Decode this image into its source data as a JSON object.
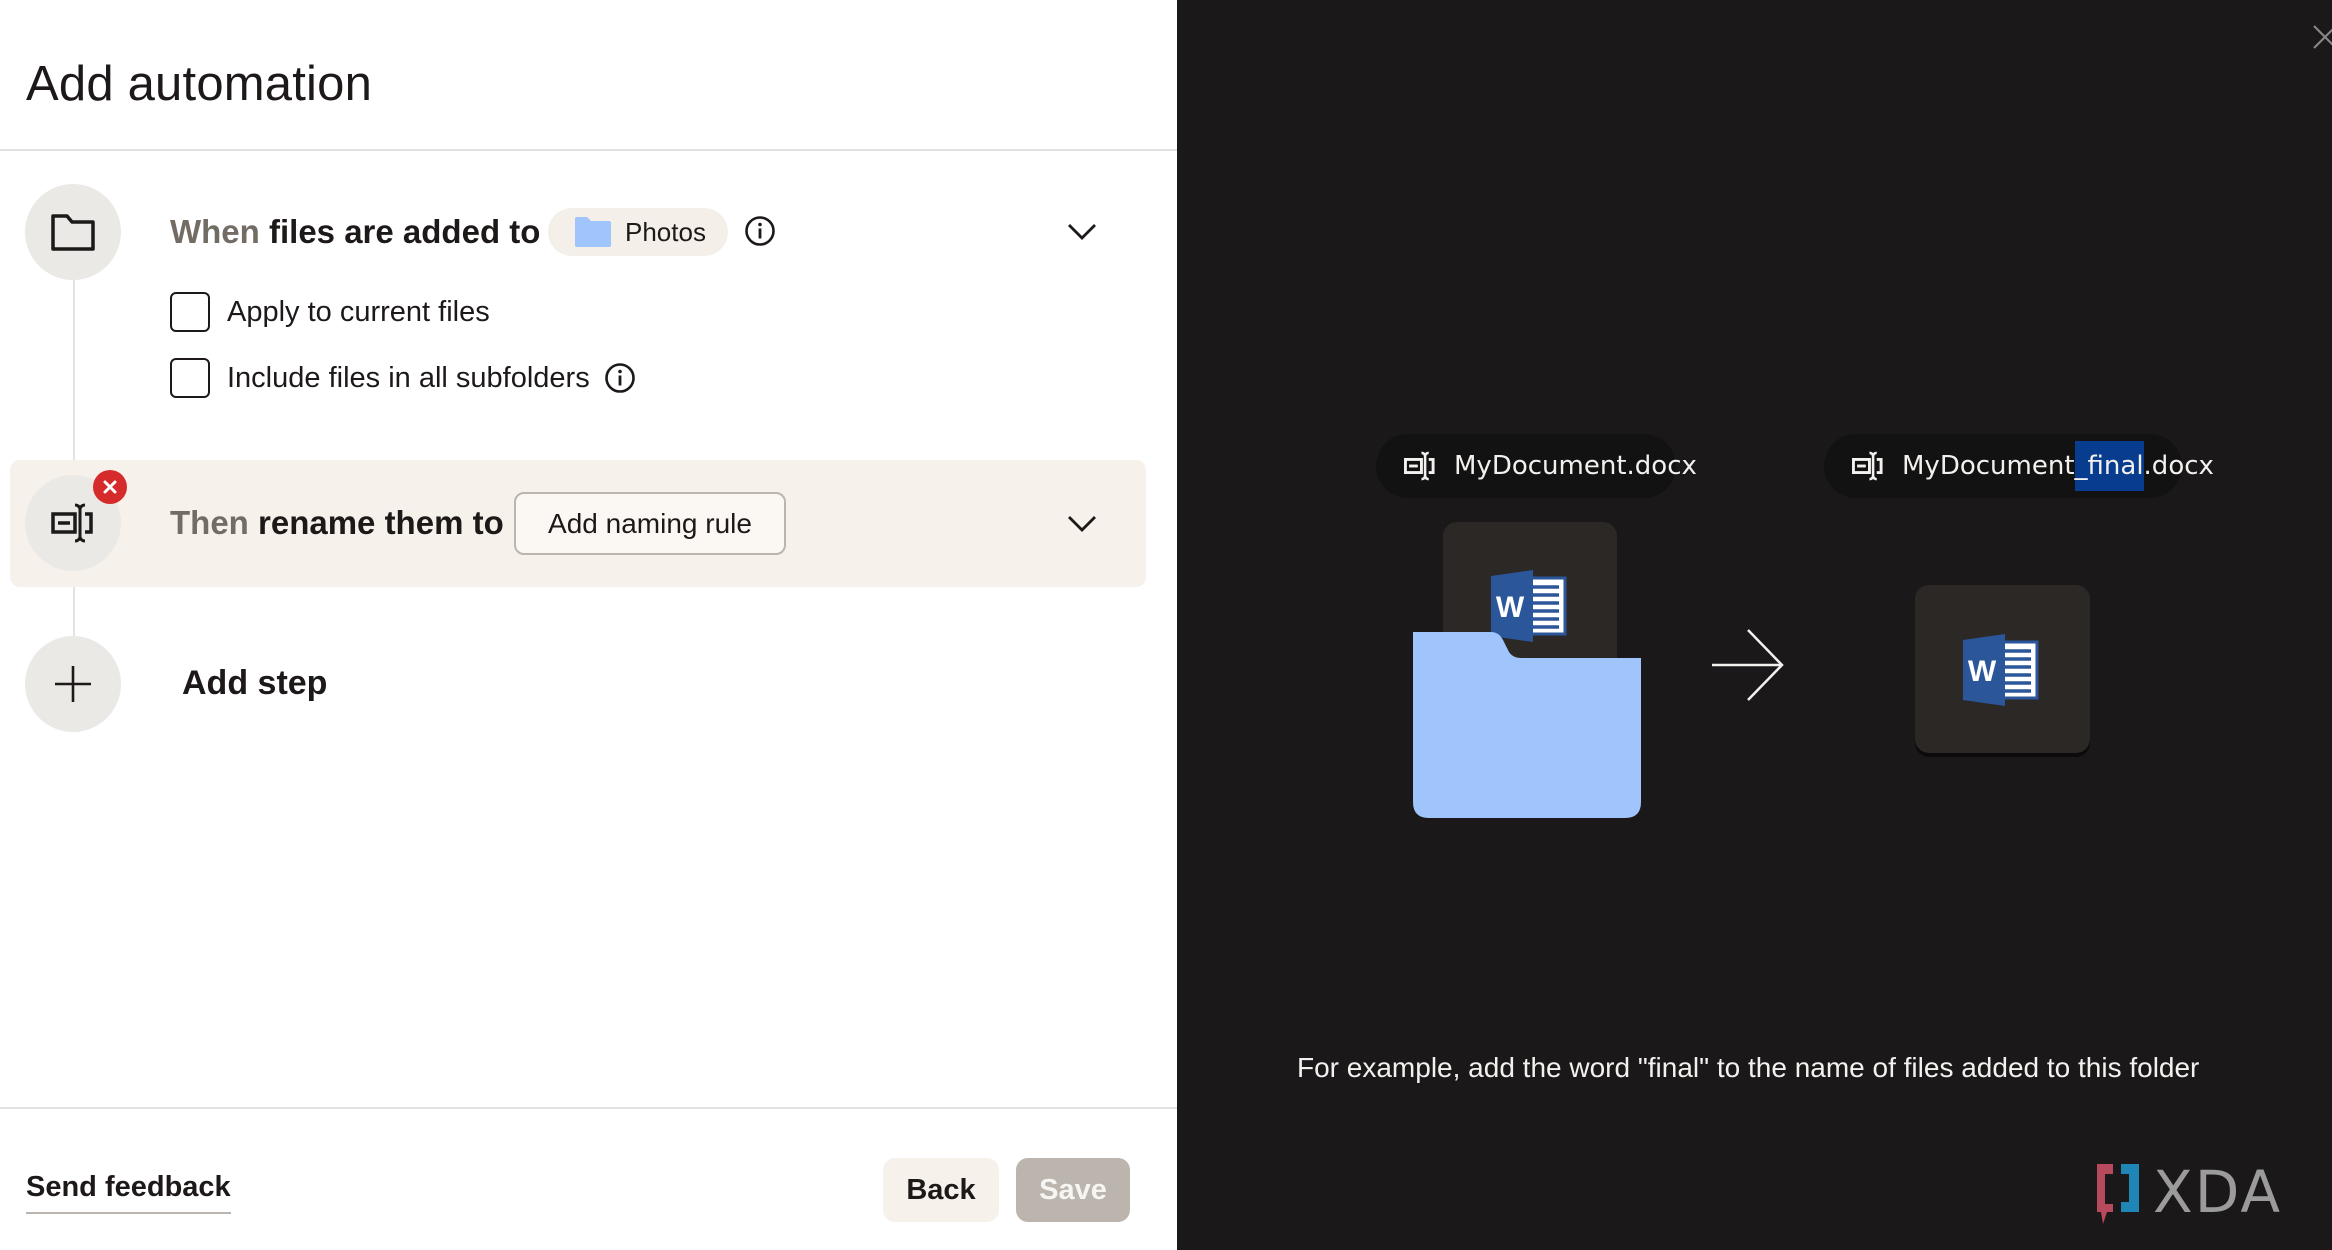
{
  "dialog": {
    "title": "Add automation"
  },
  "step_trigger": {
    "prefix": "When",
    "text": "files are added to",
    "folder_chip": "Photos",
    "icon": "folder-icon",
    "options": [
      {
        "label": "Apply to current files",
        "checked": false
      },
      {
        "label": "Include files in all subfolders",
        "checked": false,
        "has_info": true
      }
    ]
  },
  "step_action": {
    "prefix": "Then",
    "text": "rename them to",
    "button_label": "Add naming rule",
    "icon": "rename-icon",
    "error_badge": "remove-step-icon"
  },
  "add_step": {
    "label": "Add step",
    "icon": "plus-icon"
  },
  "footer": {
    "feedback_link": "Send feedback",
    "back_label": "Back",
    "save_label": "Save",
    "save_enabled": false
  },
  "preview": {
    "original_name": "MyDocument.docx",
    "renamed_parts": {
      "before": "MyDocument",
      "highlight": "_final",
      "after": ".docx"
    },
    "caption": "For example, add the word \"final\" to the name of files added to this folder",
    "watermark": "XDA"
  },
  "colors": {
    "accent_folder": "#a0c4fc",
    "error_badge": "#d52b2b",
    "highlight": "#073c8f",
    "preview_bg": "#1a1819",
    "step_highlight_bg": "#f7f1eb",
    "word_blue": "#2b579a"
  }
}
